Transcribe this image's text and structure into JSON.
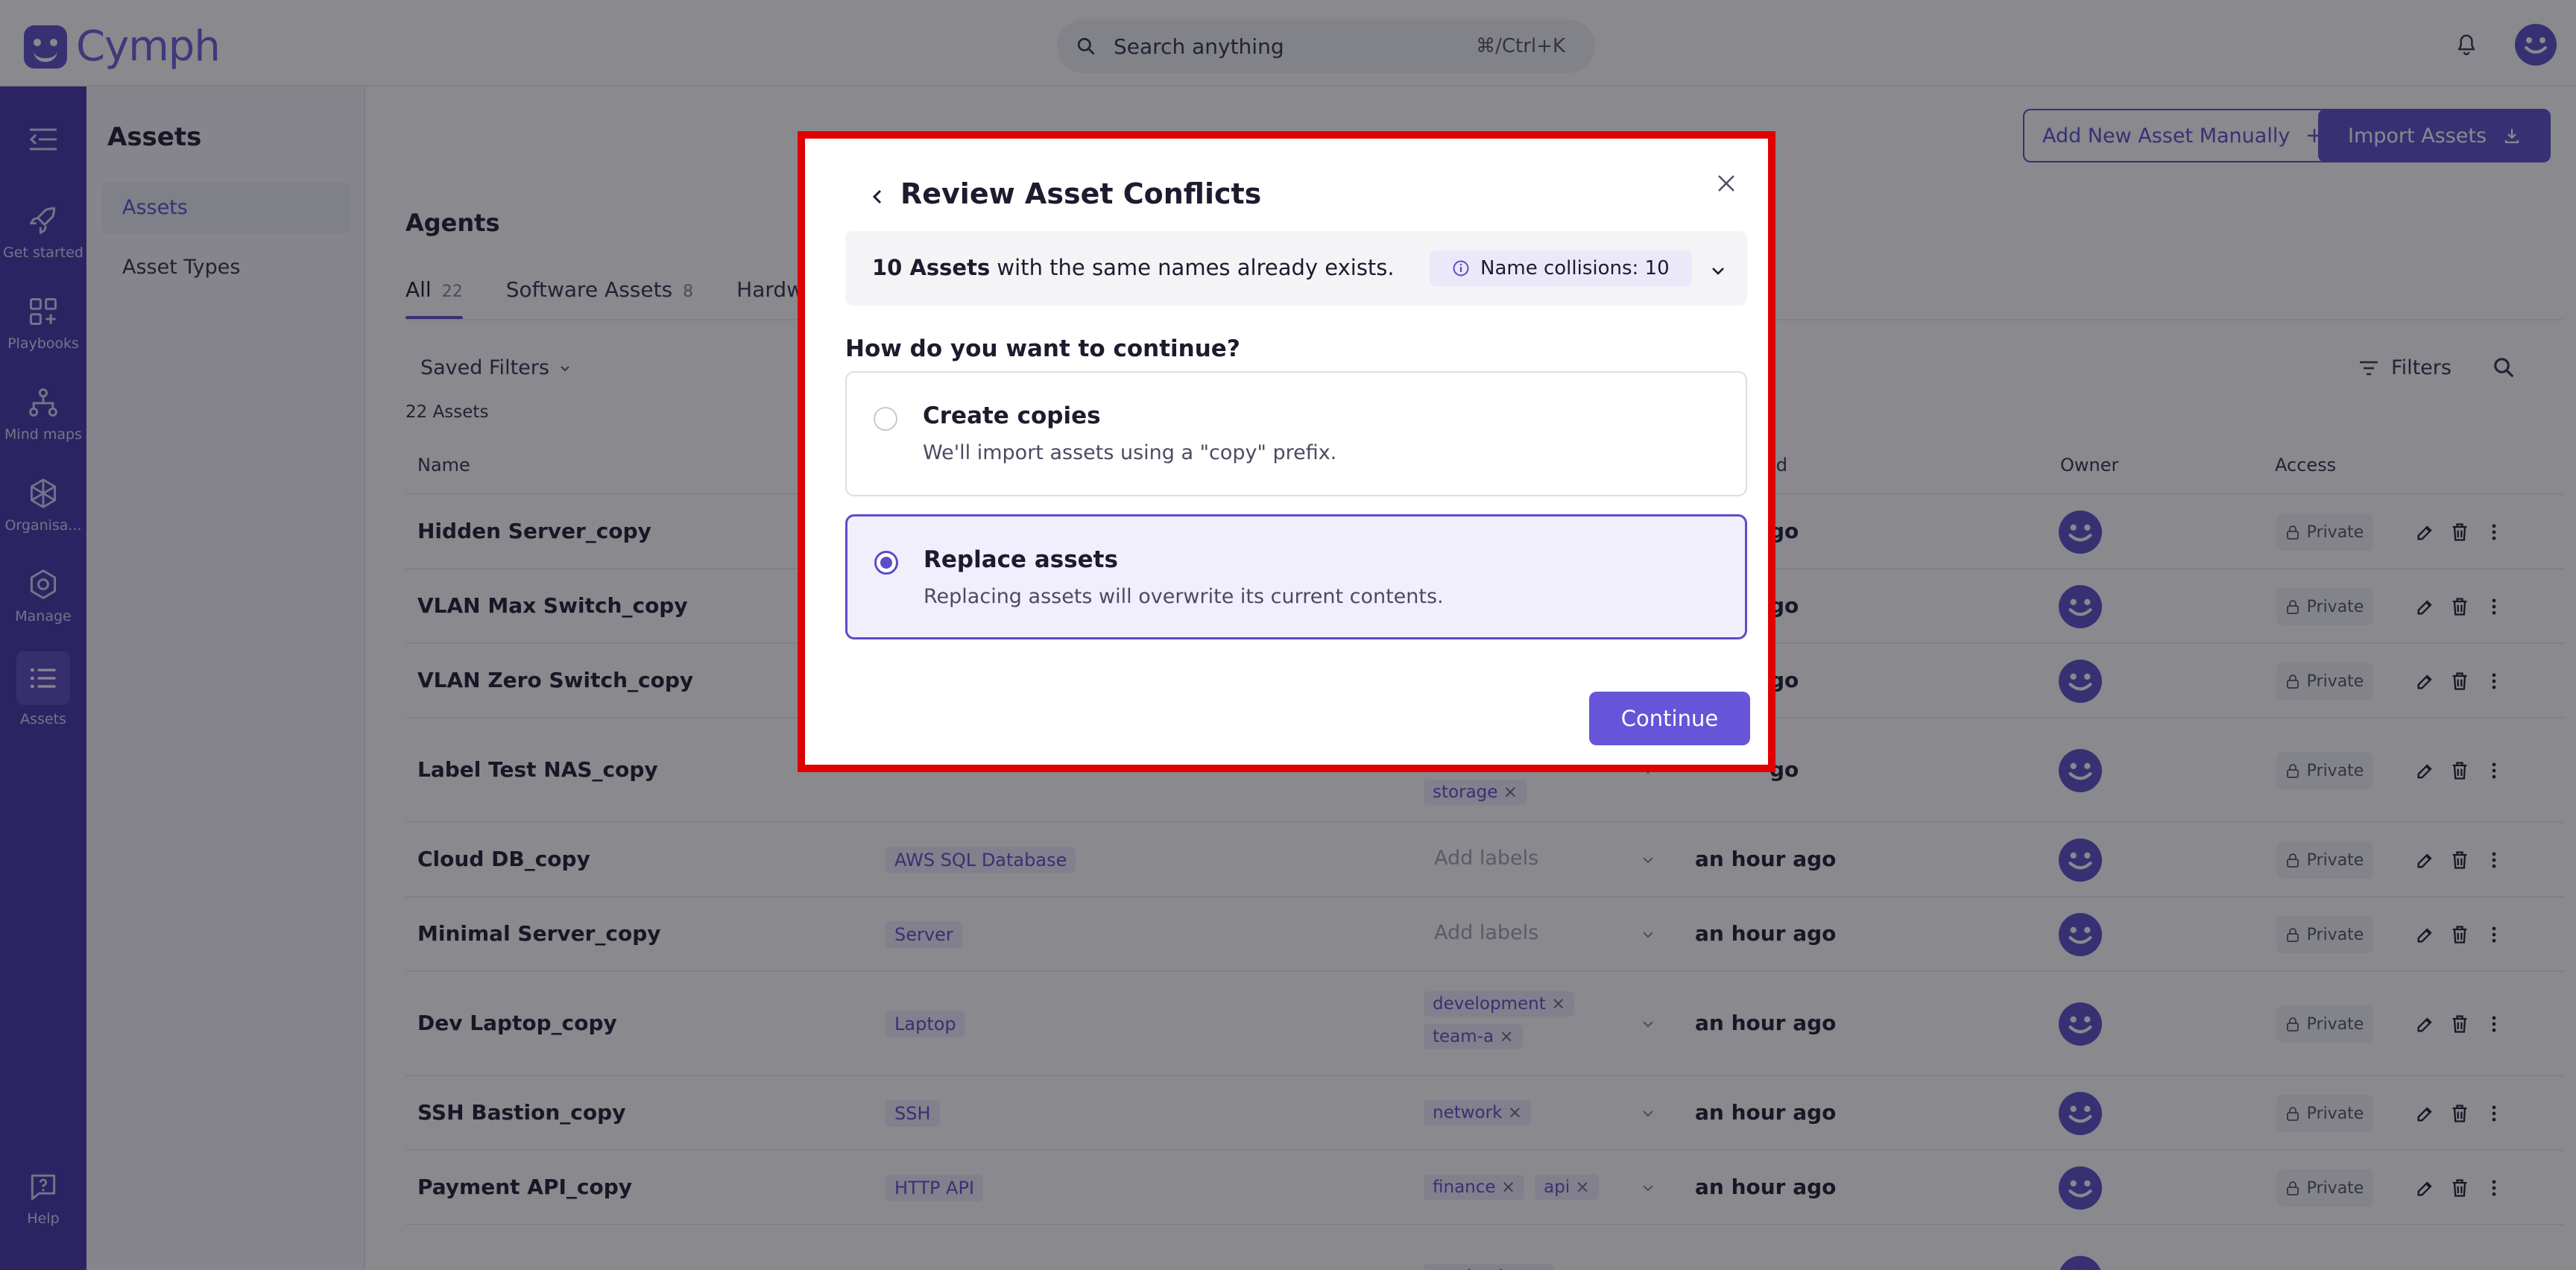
{
  "app": {
    "name": "Cymph"
  },
  "search": {
    "placeholder": "Search anything",
    "shortcut": "⌘/Ctrl+K"
  },
  "sidebar": {
    "items": [
      {
        "label": "Get started",
        "icon": "rocket-icon"
      },
      {
        "label": "Playbooks",
        "icon": "grid-plus-icon"
      },
      {
        "label": "Mind maps",
        "icon": "network-icon"
      },
      {
        "label": "Organisa...",
        "icon": "hexagon-icon"
      },
      {
        "label": "Manage",
        "icon": "settings-hex-icon"
      },
      {
        "label": "Assets",
        "icon": "list-icon"
      },
      {
        "label": "Help",
        "icon": "help-icon"
      }
    ]
  },
  "subnav": {
    "title": "Assets",
    "items": [
      {
        "label": "Assets"
      },
      {
        "label": "Asset Types"
      }
    ]
  },
  "header": {
    "add_button": "Add New Asset Manually",
    "import_button": "Import Assets"
  },
  "main": {
    "section_title": "Agents",
    "tabs": [
      {
        "label": "All",
        "count": "22"
      },
      {
        "label": "Software Assets",
        "count": "8"
      },
      {
        "label": "Hardware",
        "count": ""
      }
    ],
    "saved_filters": "Saved Filters",
    "asset_count": "22 Assets",
    "filters_label": "Filters",
    "columns": {
      "name": "Name",
      "updated": "ed",
      "owner": "Owner",
      "access": "Access"
    },
    "add_labels": "Add labels",
    "private": "Private",
    "rows": [
      {
        "name": "Hidden Server_copy",
        "type": "",
        "labels": [],
        "updated": "go"
      },
      {
        "name": "VLAN Max Switch_copy",
        "type": "",
        "labels": [],
        "updated": "go"
      },
      {
        "name": "VLAN Zero Switch_copy",
        "type": "",
        "labels": [],
        "updated": "go"
      },
      {
        "name": "Label Test NAS_copy",
        "type": "",
        "labels": [
          "storage"
        ],
        "updated": "go"
      },
      {
        "name": "Cloud DB_copy",
        "type": "AWS SQL Database",
        "labels": [],
        "updated": "an hour ago"
      },
      {
        "name": "Minimal Server_copy",
        "type": "Server",
        "labels": [],
        "updated": "an hour ago"
      },
      {
        "name": "Dev Laptop_copy",
        "type": "Laptop",
        "labels": [
          "development",
          "team-a"
        ],
        "updated": "an hour ago"
      },
      {
        "name": "SSH Bastion_copy",
        "type": "SSH",
        "labels": [
          "network"
        ],
        "updated": "an hour ago"
      },
      {
        "name": "Payment API_copy",
        "type": "HTTP API",
        "labels": [
          "finance",
          "api"
        ],
        "updated": "an hour ago"
      },
      {
        "name": "",
        "type": "",
        "labels": [
          "production"
        ],
        "updated": ""
      }
    ]
  },
  "modal": {
    "title": "Review Asset Conflicts",
    "conflict_count": "10 Assets",
    "conflict_text": " with the same names already exists.",
    "collision_badge": "Name collisions: 10",
    "question": "How do you want to continue?",
    "options": [
      {
        "title": "Create copies",
        "description": "We'll import assets using a \"copy\" prefix.",
        "selected": false
      },
      {
        "title": "Replace assets",
        "description": "Replacing assets will overwrite its current contents.",
        "selected": true
      }
    ],
    "continue_button": "Continue"
  },
  "colors": {
    "accent": "#5b4ec8",
    "sidebar": "#4535a7",
    "highlight_border": "#e00000"
  }
}
